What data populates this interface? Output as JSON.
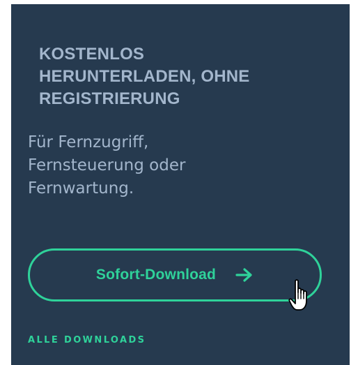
{
  "promo": {
    "headline_lines": [
      "KOSTENLOS",
      "HERUNTERLADEN, OHNE",
      "REGISTRIERUNG"
    ],
    "subtext_lines": [
      "Für Fernzugriff,",
      "Fernsteuerung oder",
      "Fernwartung."
    ],
    "download_button": {
      "label": "Sofort-Download",
      "icon": "arrow-right-icon"
    },
    "all_downloads_link": "ALLE DOWNLOADS"
  },
  "cursor": {
    "icon": "hand-pointer-icon"
  },
  "colors": {
    "panel_background": "#263a4f",
    "text_muted": "#a3b6cc",
    "accent": "#2fd29a"
  }
}
